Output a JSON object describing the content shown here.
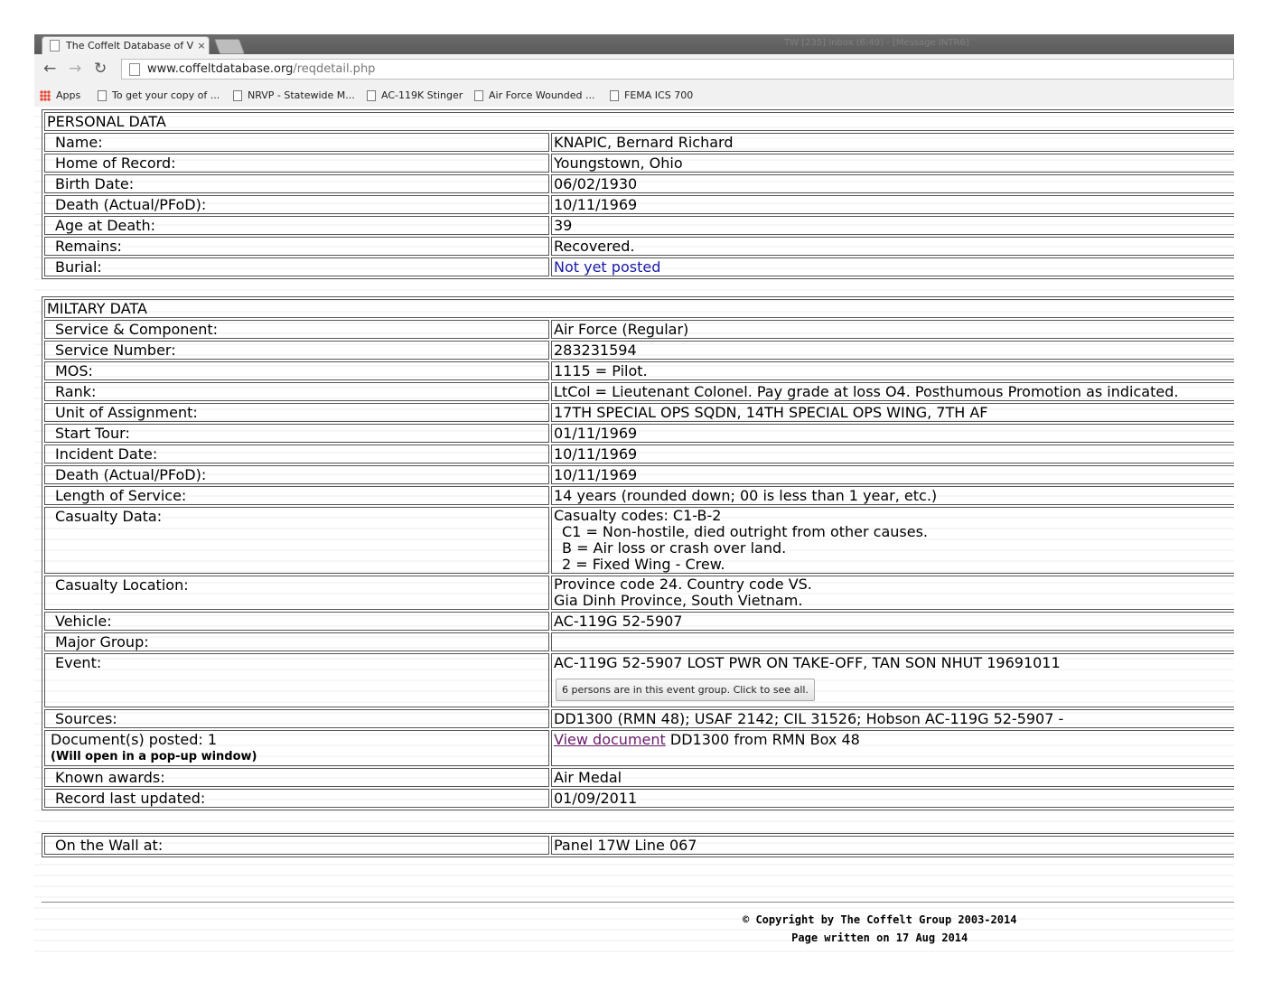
{
  "browser": {
    "tab_title": "The Coffelt Database of Vi",
    "tab_close": "×",
    "window_title": "TW [235] Inbox (6:49) - [Message INTR6]",
    "url_host": "www.coffeltdatabase.org",
    "url_path": "/reqdetail.php",
    "bookmarks": [
      "Apps",
      "To get your copy of ...",
      "NRVP - Statewide M...",
      "AC-119K Stinger",
      "Air Force Wounded ...",
      "FEMA ICS 700"
    ]
  },
  "personal": {
    "heading": "PERSONAL DATA",
    "rows": [
      {
        "label": "Name:",
        "value": "KNAPIC, Bernard Richard"
      },
      {
        "label": "Home of Record:",
        "value": "Youngstown, Ohio"
      },
      {
        "label": "Birth Date:",
        "value": "06/02/1930"
      },
      {
        "label": "Death (Actual/PFoD):",
        "value": "10/11/1969"
      },
      {
        "label": "Age at Death:",
        "value": "39"
      },
      {
        "label": "Remains:",
        "value": "Recovered."
      },
      {
        "label": "Burial:",
        "value": "Not yet posted"
      }
    ]
  },
  "military": {
    "heading": "MILTARY DATA",
    "rows": [
      {
        "label": "Service & Component:",
        "value": "Air Force (Regular)"
      },
      {
        "label": "Service Number:",
        "value": "283231594"
      },
      {
        "label": "MOS:",
        "value": "1115 = Pilot."
      },
      {
        "label": "Rank:",
        "value": "LtCol = Lieutenant Colonel. Pay grade at loss O4. Posthumous Promotion as indicated."
      },
      {
        "label": "Unit of Assignment:",
        "value": "17TH SPECIAL OPS SQDN, 14TH SPECIAL OPS WING, 7TH AF"
      },
      {
        "label": "Start Tour:",
        "value": "01/11/1969"
      },
      {
        "label": "Incident Date:",
        "value": "10/11/1969"
      },
      {
        "label": "Death (Actual/PFoD):",
        "value": "10/11/1969"
      },
      {
        "label": "Length of Service:",
        "value": "14 years (rounded down; 00 is less than 1 year, etc.)"
      }
    ],
    "casualty_data": {
      "label": "Casualty Data:",
      "lines": [
        "Casualty codes: C1-B-2",
        " C1 = Non-hostile, died outright from other causes.",
        " B = Air loss or crash over land.",
        " 2 = Fixed Wing - Crew."
      ]
    },
    "casualty_location": {
      "label": "Casualty Location:",
      "lines": [
        "Province code 24. Country code VS.",
        "Gia Dinh Province, South Vietnam."
      ]
    },
    "vehicle": {
      "label": "Vehicle:",
      "value": "AC-119G 52-5907"
    },
    "major_group": {
      "label": "Major Group:",
      "value": ""
    },
    "event": {
      "label": "Event:",
      "value": "AC-119G 52-5907 LOST PWR ON TAKE-OFF, TAN SON NHUT 19691011",
      "button": "6 persons are in this event group. Click to see all."
    },
    "sources": {
      "label": "Sources:",
      "value": "DD1300 (RMN 48); USAF 2142; CIL 31526; Hobson AC-119G 52-5907 -"
    },
    "documents": {
      "label": "Document(s) posted: 1",
      "sublabel": "(Will open in a pop-up window)",
      "link": "View document",
      "rest": " DD1300 from RMN Box 48"
    },
    "awards": {
      "label": "Known awards:",
      "value": "Air Medal"
    },
    "updated": {
      "label": "Record last updated:",
      "value": "01/09/2011"
    }
  },
  "wall": {
    "label": "On the Wall at:",
    "value": "Panel 17W Line 067"
  },
  "footer": {
    "copyright": "© Copyright by The Coffelt Group 2003-2014",
    "written": "Page written on 17 Aug 2014"
  },
  "colors": {
    "link_blue": "#1a1aa6",
    "link_visited": "#6a1b6a"
  }
}
